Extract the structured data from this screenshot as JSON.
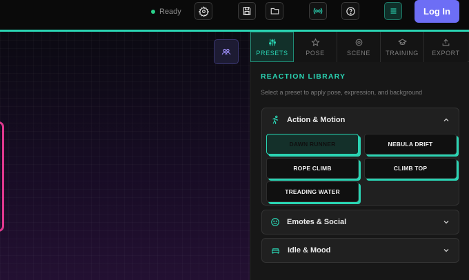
{
  "status": {
    "text": "Ready",
    "color": "#2ad08a"
  },
  "toolbar": {
    "settings_icon": "gear-icon",
    "save_icon": "save-icon",
    "open_icon": "folder-icon",
    "broadcast_icon": "broadcast-icon",
    "help_icon": "help-icon",
    "menu_icon": "menu-icon",
    "login_label": "Log In"
  },
  "canvas": {
    "group_icon": "group-icon"
  },
  "tabs": [
    {
      "label": "PRESETS",
      "icon": "sliders-icon",
      "active": true
    },
    {
      "label": "POSE",
      "icon": "star-icon",
      "active": false
    },
    {
      "label": "SCENE",
      "icon": "gear-icon",
      "active": false
    },
    {
      "label": "TRAINING",
      "icon": "graduation-cap-icon",
      "active": false
    },
    {
      "label": "EXPORT",
      "icon": "upload-icon",
      "active": false
    }
  ],
  "library": {
    "title": "REACTION LIBRARY",
    "subtitle": "Select a preset to apply pose, expression, and background"
  },
  "sections": [
    {
      "title": "Action & Motion",
      "icon": "running-icon",
      "expanded": true,
      "presets": [
        {
          "label": "DAWN RUNNER",
          "selected": true
        },
        {
          "label": "NEBULA DRIFT",
          "selected": false
        },
        {
          "label": "ROPE CLIMB",
          "selected": false
        },
        {
          "label": "CLIMB TOP",
          "selected": false
        },
        {
          "label": "TREADING WATER",
          "selected": false
        }
      ]
    },
    {
      "title": "Emotes & Social",
      "icon": "smile-icon",
      "expanded": false
    },
    {
      "title": "Idle & Mood",
      "icon": "couch-icon",
      "expanded": false
    }
  ],
  "colors": {
    "accent": "#2ad4b3",
    "brand": "#6d6ef5",
    "canvas_highlight": "#e0388e"
  }
}
